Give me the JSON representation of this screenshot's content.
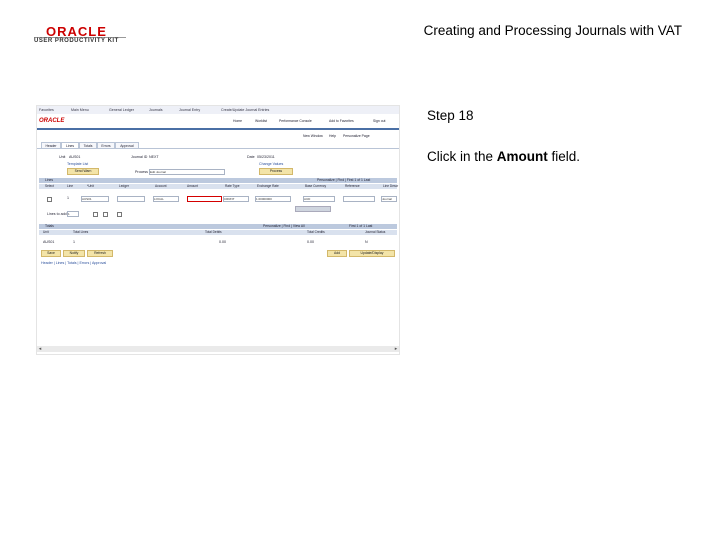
{
  "header": {
    "brand": "ORACLE",
    "product": "USER PRODUCTIVITY KIT",
    "doc_title": "Creating and Processing Journals with VAT"
  },
  "instructions": {
    "step": "Step 18",
    "prefix": "Click in the ",
    "target": "Amount",
    "suffix": " field."
  },
  "screenshot": {
    "breadcrumb": [
      "Favorites",
      "Main Menu",
      "General Ledger",
      "Journals",
      "Journal Entry",
      "Create/Update Journal Entries"
    ],
    "logo": "ORACLE",
    "top_links": [
      "Home",
      "Worklist",
      "Performance Console",
      "Add to Favorites",
      "Sign out"
    ],
    "sub_links": [
      "New Window",
      "Help",
      "Personalize Page"
    ],
    "tabs": [
      "Header",
      "Lines",
      "Totals",
      "Errors",
      "Approval"
    ],
    "unit_label": "Unit",
    "unit_value": "AUS01",
    "journal_label": "Journal ID",
    "journal_value": "NEXT",
    "date_label": "Date",
    "date_value": "05/23/2011",
    "template_label": "Template List",
    "change_values": "Change Values",
    "process_label": "Process",
    "process_value": "Edit Journal",
    "process_button": "Process",
    "send_button": "Send Warn",
    "lines_title": "Lines",
    "lines_nav": "Personalize | Find | First 1 of 1 Last",
    "columns": [
      "Select",
      "Line",
      "*Unit",
      "Ledger",
      "Account",
      "Amount",
      "Rate Type",
      "Exchange Rate",
      "Base Currency",
      "Reference",
      "Line Descr"
    ],
    "row": {
      "line": "1",
      "unit": "AUS01",
      "ledger": "LOCAL",
      "rate_type": "CRRNT",
      "exchange_rate": "1.00000000",
      "currency": "AUD",
      "descr": "Journal"
    },
    "lines_to_add_label": "Lines to add",
    "lines_to_add_value": "1",
    "totals_title": "Totals",
    "totals_nav": "Personalize | Find | View All",
    "totals_nav_right": "First 1 of 1 Last",
    "totals_columns": [
      "Unit",
      "Total Lines",
      "Total Debits",
      "Total Credits",
      "Journal Status"
    ],
    "totals_row": [
      "AUS01",
      "1",
      "0.00",
      "0.00",
      "N"
    ],
    "footer_links": "Header | Lines | Totals | Errors | Approval",
    "save_button": "Save",
    "notify_button": "Notify",
    "refresh_button": "Refresh",
    "add_button": "Add",
    "update_button": "Update/Display"
  }
}
